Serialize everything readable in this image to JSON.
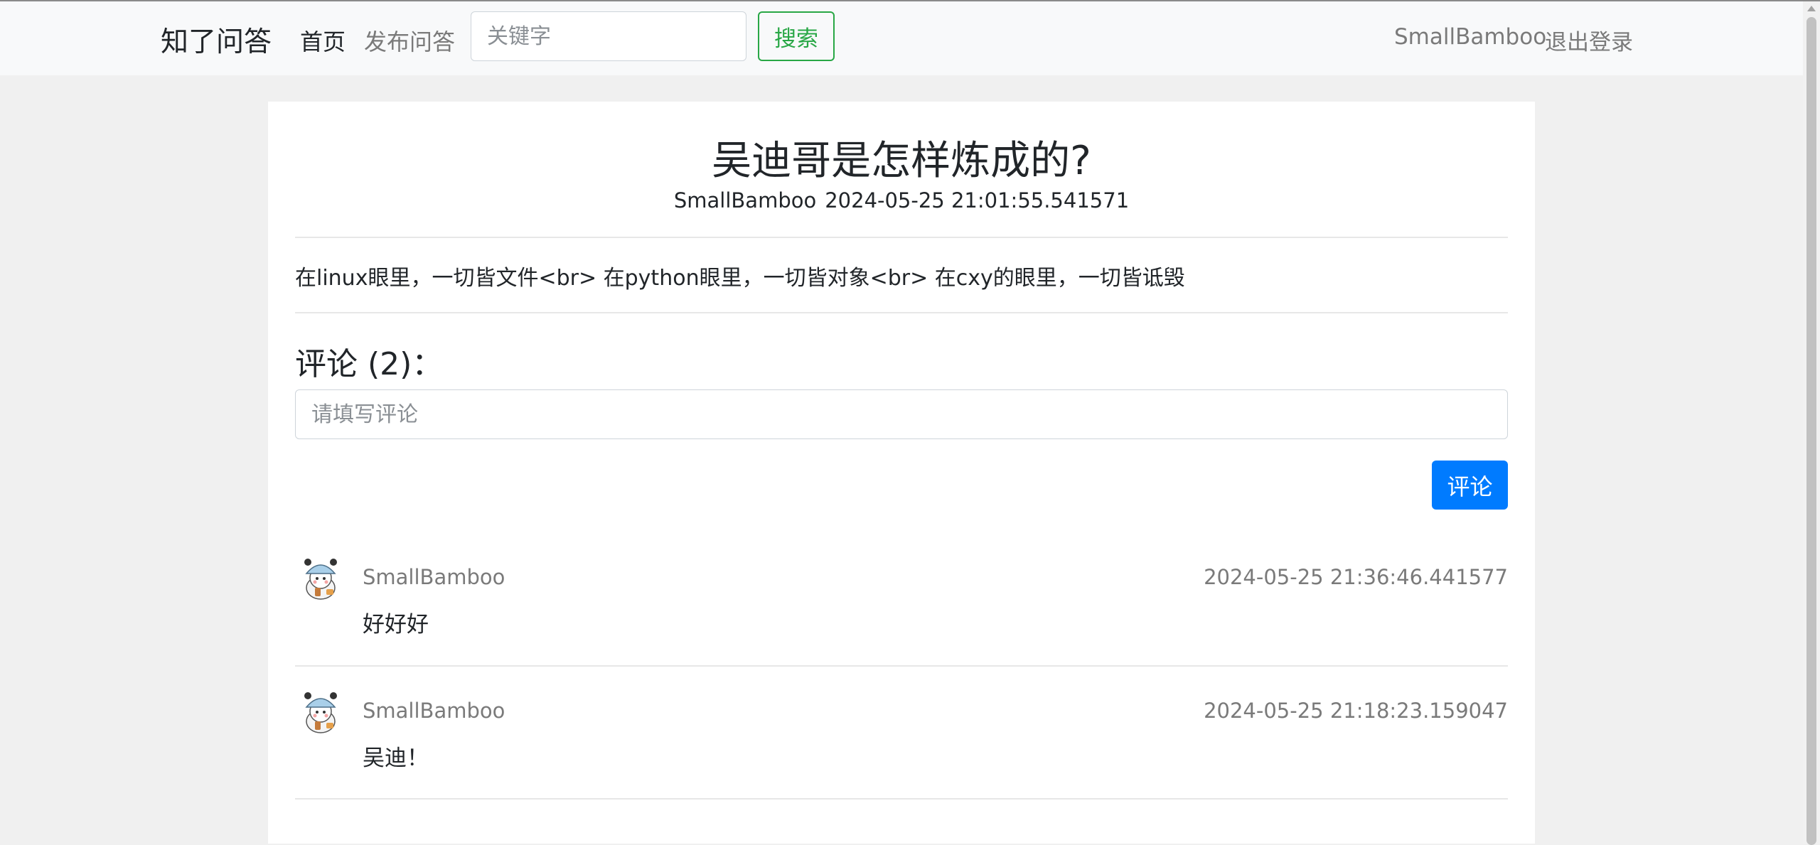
{
  "nav": {
    "brand": "知了问答",
    "home": "首页",
    "publish": "发布问答",
    "search_placeholder": "关键字",
    "search_button": "搜索",
    "username": "SmallBamboo",
    "logout": "退出登录"
  },
  "question": {
    "title": "吴迪哥是怎样炼成的?",
    "author": "SmallBamboo",
    "time": "2024-05-25 21:01:55.541571",
    "content": "在linux眼里，一切皆文件<br> 在python眼里，一切皆对象<br> 在cxy的眼里，一切皆诋毁"
  },
  "comments_section": {
    "header": "评论 (2)：",
    "placeholder": "请填写评论",
    "button": "评论",
    "items": [
      {
        "user": "SmallBamboo",
        "time": "2024-05-25 21:36:46.441577",
        "text": "好好好"
      },
      {
        "user": "SmallBamboo",
        "time": "2024-05-25 21:18:23.159047",
        "text": "吴迪！"
      }
    ]
  },
  "colors": {
    "primary": "#007bff",
    "success": "#28a745",
    "navbar_bg": "#f8f9fa",
    "page_bg": "#f0f0f0"
  }
}
